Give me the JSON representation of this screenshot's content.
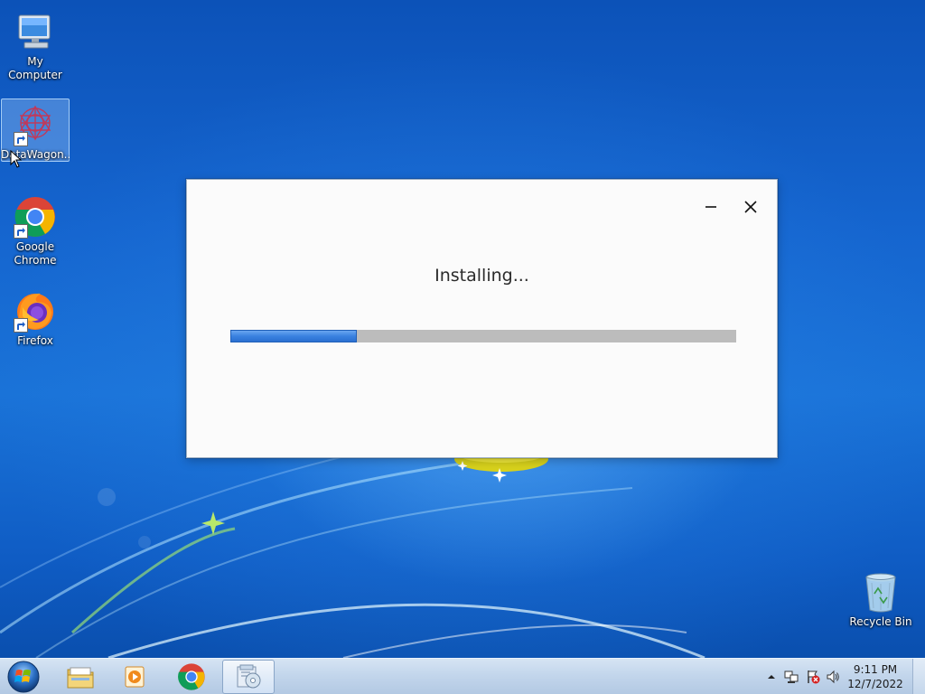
{
  "desktop": {
    "icons": [
      {
        "label": "My Computer",
        "icon": "computer-icon"
      },
      {
        "label": "DataWagon...",
        "icon": "datawagon-icon",
        "selected": true
      },
      {
        "label": "Google Chrome",
        "icon": "chrome-icon"
      },
      {
        "label": "Firefox",
        "icon": "firefox-icon"
      },
      {
        "label": "Recycle Bin",
        "icon": "recycle-bin-icon"
      }
    ]
  },
  "dialog": {
    "status_text": "Installing...",
    "progress_fraction": 0.25,
    "minimize_icon": "minimize-icon",
    "close_icon": "close-icon"
  },
  "taskbar": {
    "start_icon": "windows-start-icon",
    "pinned": [
      {
        "name": "File Explorer",
        "icon": "folder-icon"
      },
      {
        "name": "Media Player",
        "icon": "media-player-icon"
      },
      {
        "name": "Google Chrome",
        "icon": "chrome-icon"
      },
      {
        "name": "Installer",
        "icon": "installer-icon",
        "active": true
      }
    ],
    "tray": {
      "icons": [
        "show-hidden-icons-arrow",
        "network-icon",
        "action-center-flag-icon",
        "volume-icon"
      ],
      "time": "9:11 PM",
      "date": "12/7/2022"
    }
  },
  "colors": {
    "progress_fill": "#3a82e0",
    "progress_track": "#bcbcbc",
    "desktop_blue": "#1565cf"
  }
}
